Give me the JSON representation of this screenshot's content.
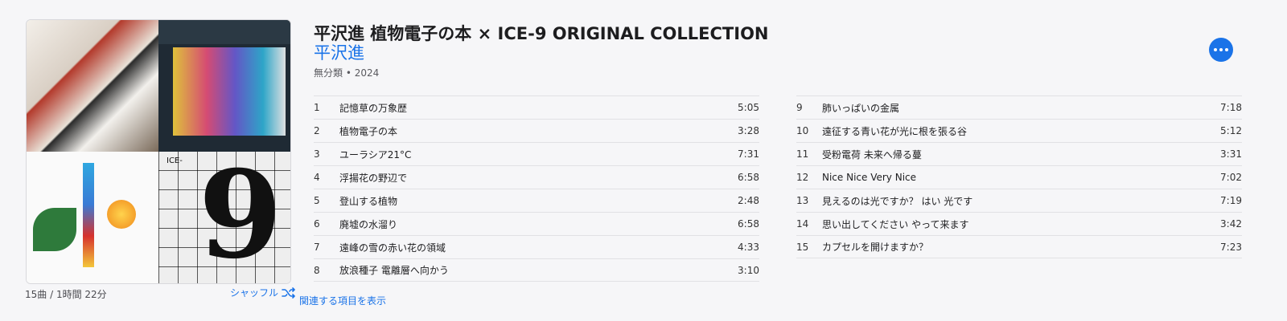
{
  "album": {
    "title": "平沢進 植物電子の本 × ICE-9 ORIGINAL COLLECTION",
    "artist": "平沢進",
    "subtitle": "無分類 • 2024",
    "summary": "15曲 / 1時間 22分",
    "shuffle_label": "シャッフル",
    "related_label": "関連する項目を表示",
    "more_icon": "more-icon",
    "shuffle_icon": "shuffle-icon",
    "accent_color": "#1a73e8",
    "artwork_text": {
      "ice9": "ICE-",
      "nine": "9"
    }
  },
  "tracks_left": [
    {
      "num": "1",
      "name": "記憶草の万象歴",
      "dur": "5:05"
    },
    {
      "num": "2",
      "name": "植物電子の本",
      "dur": "3:28"
    },
    {
      "num": "3",
      "name": "ユーラシア21°C",
      "dur": "7:31"
    },
    {
      "num": "4",
      "name": "浮揚花の野辺で",
      "dur": "6:58"
    },
    {
      "num": "5",
      "name": "登山する植物",
      "dur": "2:48"
    },
    {
      "num": "6",
      "name": "廃墟の水溜り",
      "dur": "6:58"
    },
    {
      "num": "7",
      "name": "遠峰の雪の赤い花の領域",
      "dur": "4:33"
    },
    {
      "num": "8",
      "name": "放浪種子 電離層へ向かう",
      "dur": "3:10"
    }
  ],
  "tracks_right": [
    {
      "num": "9",
      "name": "肺いっぱいの金属",
      "dur": "7:18"
    },
    {
      "num": "10",
      "name": "遠征する青い花が光に根を張る谷",
      "dur": "5:12"
    },
    {
      "num": "11",
      "name": "受粉電荷 未来へ帰る蔓",
      "dur": "3:31"
    },
    {
      "num": "12",
      "name": "Nice Nice Very Nice",
      "dur": "7:02"
    },
    {
      "num": "13",
      "name": "見えるのは光ですか？ はい 光です",
      "dur": "7:19"
    },
    {
      "num": "14",
      "name": "思い出してください やって来ます",
      "dur": "3:42"
    },
    {
      "num": "15",
      "name": "カプセルを開けますか？",
      "dur": "7:23"
    }
  ]
}
